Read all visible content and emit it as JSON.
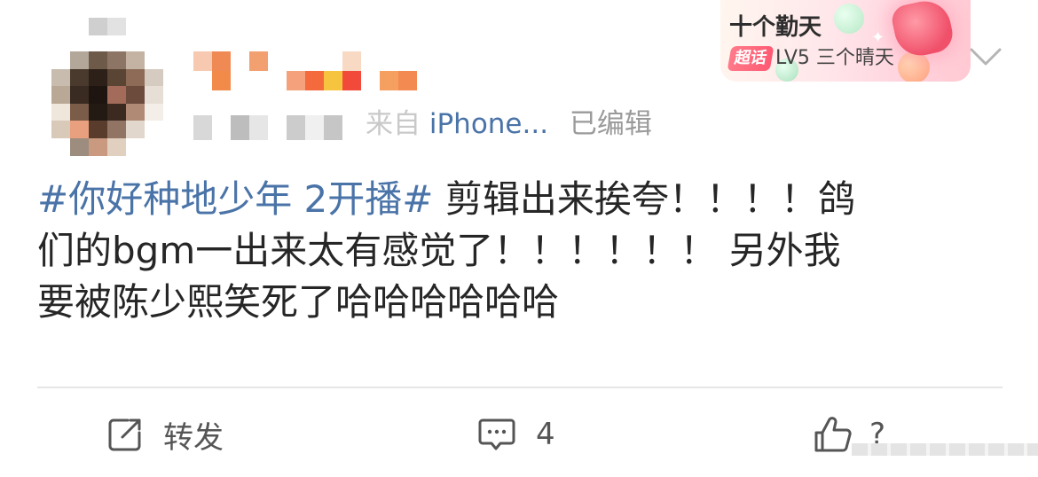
{
  "post": {
    "meta": {
      "source_label": "来自",
      "device": "iPhone...",
      "edited": "已编辑"
    },
    "text": {
      "hashtag": "#你好种地少年 2开播#",
      "line1_rest": " 剪辑出来挨夸！！！！鸽",
      "line2": "们的bgm一出来太有感觉了！！！！！！ 另外我",
      "line3": "要被陈少熙笑死了哈哈哈哈哈哈"
    }
  },
  "badge": {
    "title": "十个勤天",
    "tag": "超话",
    "level": "LV5",
    "level_name": "三个晴天"
  },
  "actions": {
    "repost_label": "转发",
    "comment_count": "4",
    "like_count": "?"
  },
  "icons": {
    "more_menu": "chevron-down-icon",
    "repost": "share-square-icon",
    "comment": "comment-bubble-icon",
    "like": "thumbs-up-icon"
  },
  "colors": {
    "hashtag": "#4a73a8",
    "text": "#262626",
    "muted": "#9a9a9a",
    "badge_tag": "#ff5a73"
  }
}
